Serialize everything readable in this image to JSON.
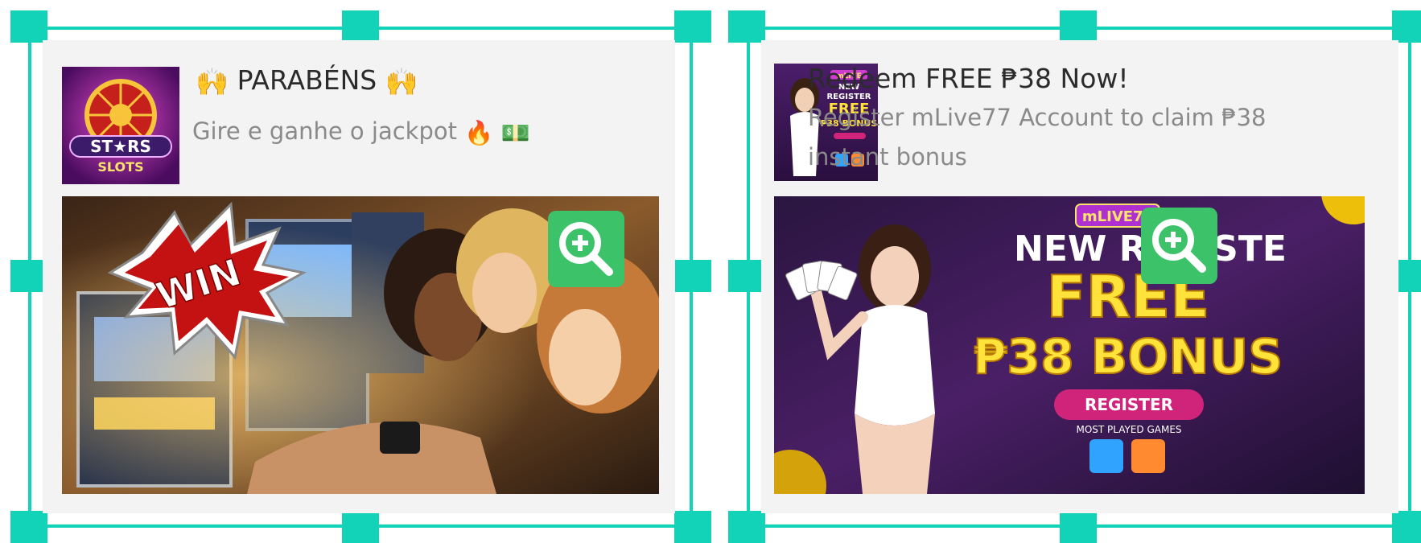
{
  "cards": [
    {
      "title_prefix": "🙌",
      "title_text": "PARABÉNS",
      "title_suffix": "🙌",
      "subtitle_text": "Gire e ganhe o jackpot",
      "subtitle_emojis": [
        "🔥",
        "💵"
      ],
      "thumb_logo_top": "ST★RS",
      "thumb_logo_bottom": "SLOTS",
      "banner_badge": "WIN"
    },
    {
      "title_text": "Redeem FREE ₱38 Now!",
      "subtitle_line1": "Register mLive77 Account to claim ₱38",
      "subtitle_line2": "instant bonus",
      "thumb_brand": "mLIVE",
      "thumb_line1": "NEW",
      "thumb_line2": "REGISTER",
      "thumb_line3": "FREE",
      "thumb_line4": "₱38 BONUS",
      "banner_brand": "mLIVE77",
      "banner_headline": "NEW REGISTE",
      "banner_free": "FREE",
      "banner_bonus": "₱38 BONUS",
      "banner_button": "REGISTER",
      "banner_caption": "MOST PLAYED GAMES"
    }
  ],
  "colors": {
    "frame": "#12d2b8",
    "zoom": "#3cc36a",
    "card_bg": "#f3f3f3"
  },
  "icons": {
    "zoom": "zoom-in-icon"
  }
}
